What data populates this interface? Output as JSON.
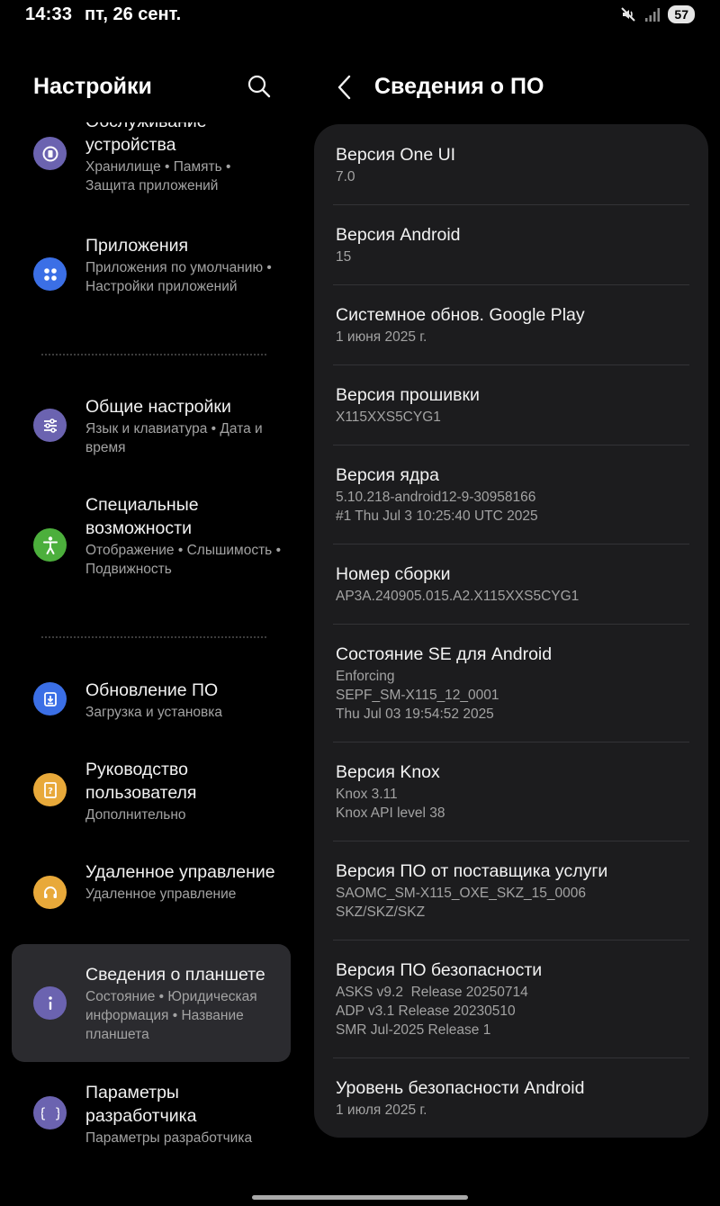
{
  "status_bar": {
    "time": "14:33",
    "date": "пт, 26 сент.",
    "battery": "57",
    "icons": [
      "mute-icon",
      "signal-icon"
    ]
  },
  "left_pane": {
    "title": "Настройки",
    "search_icon": "search-icon",
    "items": [
      {
        "title": "Обслуживание устройства",
        "subtitle": "Хранилище • Память • Защита приложений",
        "icon": "device-care-icon",
        "color": "#6b63b0"
      },
      {
        "title": "Приложения",
        "subtitle": "Приложения по умолчанию • Настройки приложений",
        "icon": "apps-icon",
        "color": "#3b6fe6"
      },
      {
        "title": "Общие настройки",
        "subtitle": "Язык и клавиатура • Дата и время",
        "icon": "sliders-icon",
        "color": "#6b63b0"
      },
      {
        "title": "Специальные возможности",
        "subtitle": "Отображение • Слышимость • Подвижность",
        "icon": "accessibility-icon",
        "color": "#4caf3c"
      },
      {
        "title": "Обновление ПО",
        "subtitle": "Загрузка и установка",
        "icon": "software-update-icon",
        "color": "#3b6fe6"
      },
      {
        "title": "Руководство пользователя",
        "subtitle": "Дополнительно",
        "icon": "user-manual-icon",
        "color": "#e8a93a"
      },
      {
        "title": "Удаленное управление",
        "subtitle": "Удаленное управление",
        "icon": "headset-icon",
        "color": "#e8a93a"
      },
      {
        "title": "Сведения о планшете",
        "subtitle": "Состояние • Юриди­ческая информация • Название планшета",
        "icon": "info-icon",
        "color": "#6b63b0"
      },
      {
        "title": "Параметры разработчика",
        "subtitle": "Параметры разработчика",
        "icon": "developer-braces-icon",
        "color": "#6b63b0"
      }
    ]
  },
  "right_pane": {
    "title": "Сведения о ПО",
    "back_icon": "back-arrow-icon",
    "rows": [
      {
        "label": "Версия One UI",
        "value": "7.0"
      },
      {
        "label": "Версия Android",
        "value": "15"
      },
      {
        "label": "Системное обнов. Google Play",
        "value": "1 июня 2025 г."
      },
      {
        "label": "Версия прошивки",
        "value": "X115XXS5CYG1"
      },
      {
        "label": "Версия ядра",
        "value": "5.10.218-android12-9-30958166\n#1 Thu Jul 3 10:25:40 UTC 2025"
      },
      {
        "label": "Номер сборки",
        "value": "AP3A.240905.015.A2.X115XXS5CYG1"
      },
      {
        "label": "Состояние SE для Android",
        "value": "Enforcing\nSEPF_SM-X115_12_0001\nThu Jul 03 19:54:52 2025"
      },
      {
        "label": "Версия Knox",
        "value": "Knox 3.11\nKnox API level 38"
      },
      {
        "label": "Версия ПО от поставщика услуги",
        "value": "SAOMC_SM-X115_OXE_SKZ_15_0006\nSKZ/SKZ/SKZ"
      },
      {
        "label": "Версия ПО безопасности",
        "value": "ASKS v9.2  Release 20250714\nADP v3.1 Release 20230510\nSMR Jul-2025 Release 1"
      },
      {
        "label": "Уровень безопасности Android",
        "value": "1 июля 2025 г."
      }
    ]
  }
}
